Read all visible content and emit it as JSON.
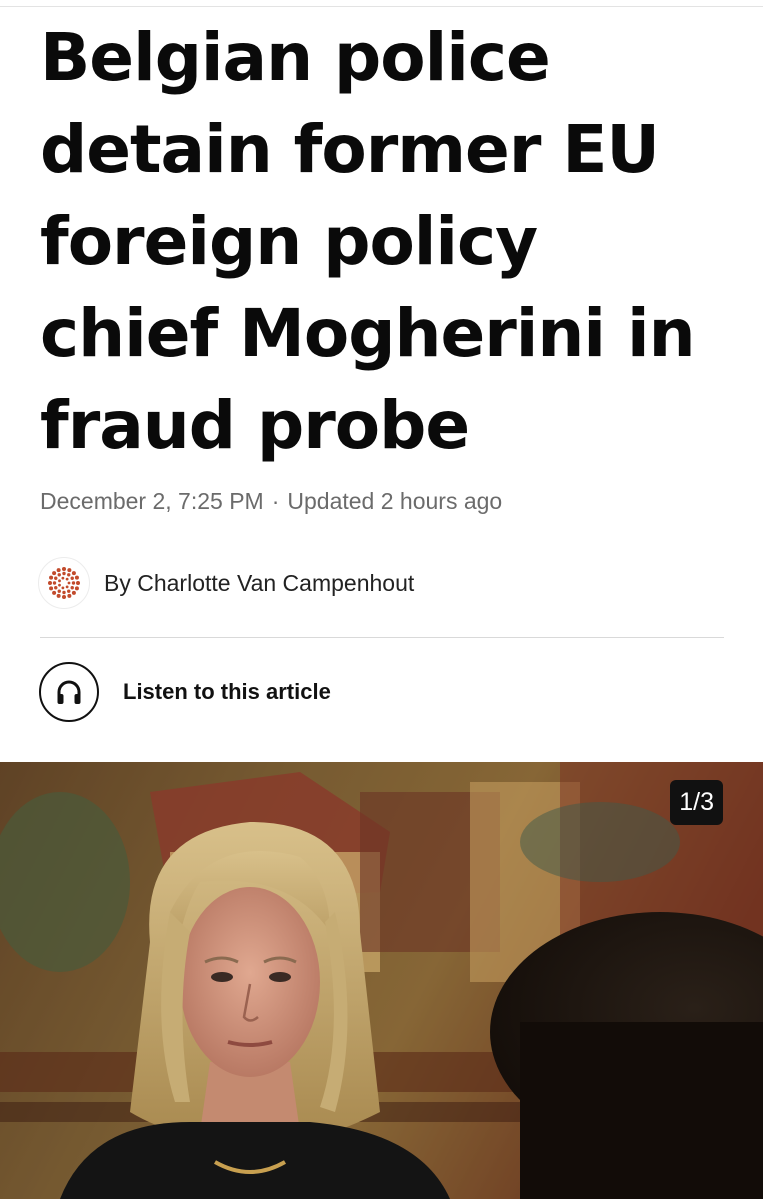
{
  "article": {
    "headline": "Belgian police detain former EU foreign policy chief Mogherini in fraud probe",
    "date": "December 2, 7:25 PM",
    "separator": "·",
    "updated": "Updated 2 hours ago",
    "byline": "By Charlotte Van Campenhout"
  },
  "audio": {
    "label": "Listen to this article",
    "icon": "headphones-icon"
  },
  "gallery": {
    "counter": "1/3"
  },
  "colors": {
    "text": "#0a0a0a",
    "meta": "#6b6b6b",
    "logo_accent": "#c24b2c",
    "counter_bg": "#111111"
  }
}
